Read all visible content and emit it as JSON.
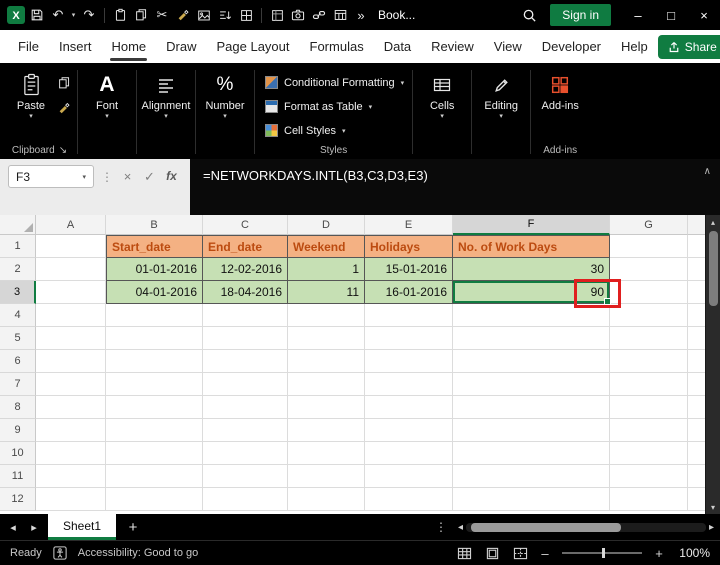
{
  "titlebar": {
    "filename": "Book...",
    "sign_in_label": "Sign in"
  },
  "icons": {
    "undo": "↶",
    "redo": "↷",
    "cut": "✂",
    "overflow_chevron": "»",
    "dropdown_caret": "▾",
    "formula_dots": "⋮",
    "cancel": "×",
    "enter": "✓",
    "insert_function": "fx",
    "collapse_formula_bar": "∧",
    "nav_left": "◂",
    "nav_right": "▸",
    "scroll_up": "▴",
    "scroll_down": "▾",
    "add_sheet": "+",
    "sheet_menu_dots": "⋮",
    "zoom_out": "–",
    "zoom_in": "+",
    "dialog_launcher": "↘",
    "minimize": "–",
    "maximize": "□",
    "close": "×"
  },
  "menu": {
    "tabs": [
      "File",
      "Insert",
      "Home",
      "Draw",
      "Page Layout",
      "Formulas",
      "Data",
      "Review",
      "View",
      "Developer",
      "Help"
    ],
    "active_tab": "Home",
    "share_label": "Share"
  },
  "ribbon": {
    "paste_label": "Paste",
    "font_label": "Font",
    "alignment_label": "Alignment",
    "number_label": "Number",
    "styles_buttons": [
      "Conditional Formatting",
      "Format as Table",
      "Cell Styles"
    ],
    "cells_label": "Cells",
    "editing_label": "Editing",
    "addins_button_label": "Add-ins",
    "group_labels": {
      "clipboard": "Clipboard",
      "styles": "Styles",
      "addins": "Add-ins"
    }
  },
  "formula_bar": {
    "name_box": "F3",
    "formula": "=NETWORKDAYS.INTL(B3,C3,D3,E3)"
  },
  "grid": {
    "columns": [
      "A",
      "B",
      "C",
      "D",
      "E",
      "F",
      "G"
    ],
    "rows": [
      "1",
      "2",
      "3",
      "4",
      "5",
      "6",
      "7",
      "8",
      "9",
      "10",
      "11",
      "12"
    ],
    "selected_column": "F",
    "selected_row": "3",
    "active_cell": "F3",
    "table": {
      "headers": [
        "Start_date",
        "End_date",
        "Weekend",
        "Holidays",
        "No. of Work Days"
      ],
      "rows": [
        [
          "01-01-2016",
          "12-02-2016",
          "1",
          "15-01-2016",
          "30"
        ],
        [
          "04-01-2016",
          "18-04-2016",
          "11",
          "16-01-2016",
          "90"
        ]
      ]
    }
  },
  "sheet_bar": {
    "sheet_name": "Sheet1"
  },
  "status_bar": {
    "ready_label": "Ready",
    "accessibility_label": "Accessibility: Good to go",
    "zoom_level": "100%"
  },
  "colors": {
    "accent_green": "#107C41",
    "titlebar_bg": "#000000",
    "ribbon_bg": "#000000",
    "table_header_bg": "#F4B183",
    "table_header_text": "#BC4B10",
    "table_row_bg": "#C6E0B4",
    "selection_green": "#107C41",
    "annotation_red": "#E01F1F"
  }
}
